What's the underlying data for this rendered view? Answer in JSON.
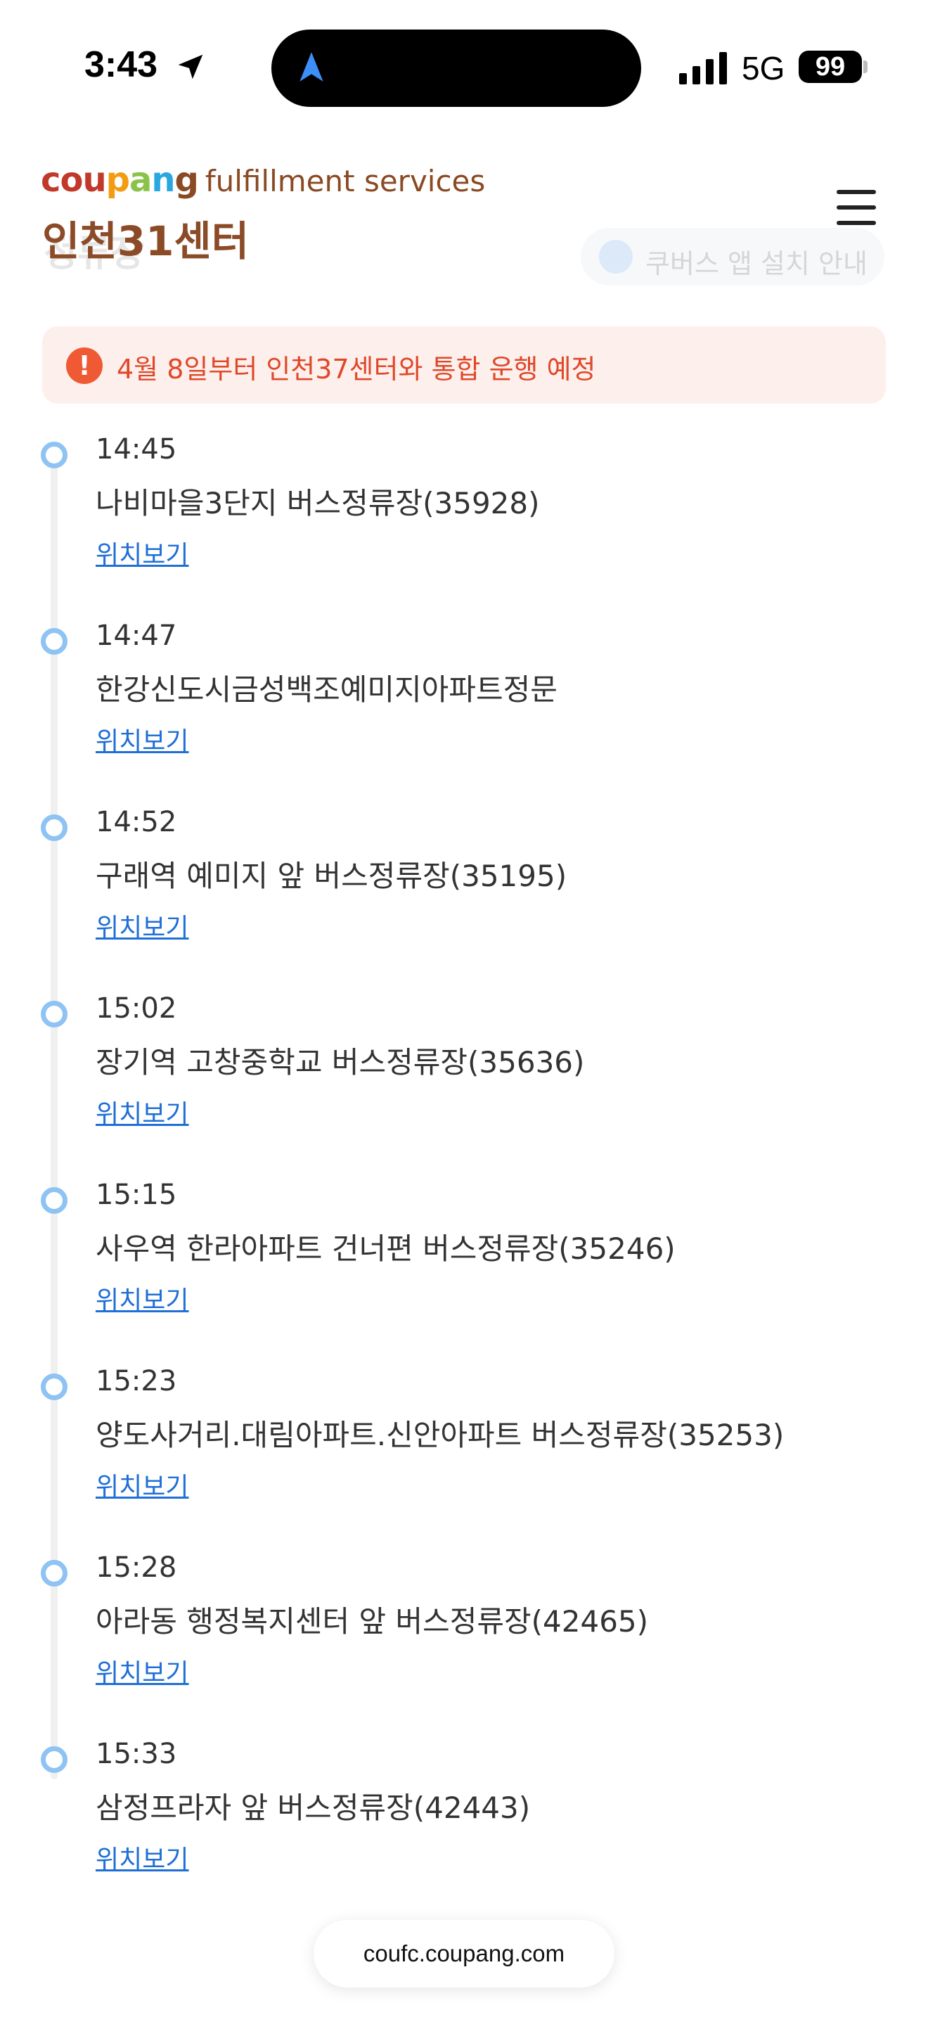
{
  "status_bar": {
    "time": "3:43",
    "network": "5G",
    "battery": "99"
  },
  "header": {
    "logo_brand": "coupang",
    "logo_suffix": "fulfillment services",
    "center_name": "인천31센터",
    "ghost_title": "정류장",
    "ghost_chip_label": "쿠버스 앱 설치 안내",
    "brand_colors": [
      "#c0392b",
      "#f39c12",
      "#8bc34a",
      "#29a8e0",
      "#8a4a23"
    ]
  },
  "notice": {
    "icon": "!",
    "text": "4월 8일부터 인천37센터와 통합 운행 예정"
  },
  "stops": [
    {
      "time": "14:45",
      "name": "나비마을3단지 버스정류장(35928)",
      "link": "위치보기"
    },
    {
      "time": "14:47",
      "name": "한강신도시금성백조예미지아파트정문",
      "link": "위치보기"
    },
    {
      "time": "14:52",
      "name": "구래역 예미지 앞 버스정류장(35195)",
      "link": "위치보기"
    },
    {
      "time": "15:02",
      "name": "장기역 고창중학교 버스정류장(35636)",
      "link": "위치보기"
    },
    {
      "time": "15:15",
      "name": "사우역 한라아파트 건너편 버스정류장(35246)",
      "link": "위치보기"
    },
    {
      "time": "15:23",
      "name": "양도사거리.대림아파트.신안아파트 버스정류장(35253)",
      "link": "위치보기"
    },
    {
      "time": "15:28",
      "name": "아라동 행정복지센터 앞 버스정류장(42465)",
      "link": "위치보기"
    },
    {
      "time": "15:33",
      "name": "삼정프라자 앞 버스정류장(42443)",
      "link": "위치보기"
    }
  ],
  "browser": {
    "url": "coufc.coupang.com"
  }
}
